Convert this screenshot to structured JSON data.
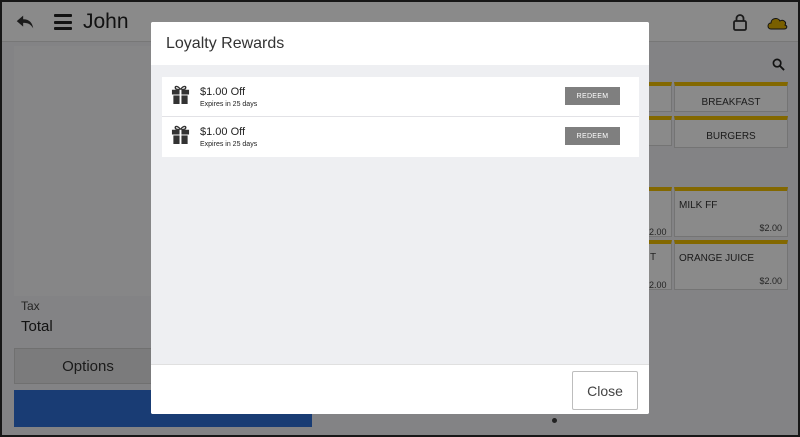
{
  "topbar": {
    "user_name": "John",
    "icons": [
      "back-arrow-icon",
      "hamburger-menu-icon",
      "lock-icon",
      "cloud-icon"
    ]
  },
  "order_summary": {
    "tax_label": "Tax",
    "total_label": "Total",
    "options_label": "Options"
  },
  "menu": {
    "categories": [
      {
        "name": "BREAKFAST"
      },
      {
        "name": "BURGERS"
      }
    ],
    "items": [
      {
        "name": "MILK FF",
        "price": "$2.00",
        "peek_price": "$2.00"
      },
      {
        "name": "ORANGE JUICE",
        "price": "$2.00",
        "peek_price": "$2.00",
        "peek_label": "T"
      }
    ]
  },
  "modal": {
    "title": "Loyalty Rewards",
    "rewards": [
      {
        "title": "$1.00 Off",
        "subtitle": "Expires in 25 days",
        "button_label": "REDEEM",
        "icon": "gift-icon"
      },
      {
        "title": "$1.00 Off",
        "subtitle": "Expires in 25 days",
        "button_label": "REDEEM",
        "icon": "gift-icon"
      }
    ],
    "close_label": "Close"
  },
  "colors": {
    "accent_yellow": "#f2c100",
    "primary_blue": "#2f6fd6",
    "redeem_gray": "#7f7f7f"
  }
}
